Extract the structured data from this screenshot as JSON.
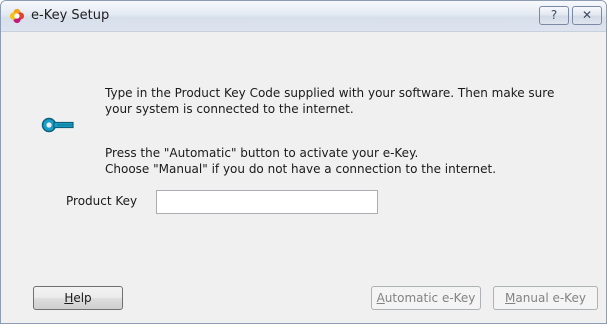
{
  "window": {
    "title": "e-Key Setup",
    "help_glyph": "?",
    "close_glyph": "✕",
    "app_icon": "setup-flower-icon"
  },
  "instructions": {
    "line1": "Type in the Product Key Code supplied with your software.  Then make sure",
    "line2": "your system is connected to the internet.",
    "line3": "Press the \"Automatic\" button to activate your e-Key.",
    "line4": "Choose \"Manual\" if you do not have a connection to the internet.",
    "icon": "key-icon"
  },
  "form": {
    "product_key_label": "Product Key",
    "product_key_value": ""
  },
  "buttons": {
    "help_prefix": "",
    "help_accel": "H",
    "help_rest": "elp",
    "auto_accel": "A",
    "auto_rest": "utomatic e-Key",
    "manual_accel": "M",
    "manual_rest": "anual e-Key",
    "auto_enabled": false,
    "manual_enabled": false
  },
  "colors": {
    "dialog_bg": "#f0f0f0",
    "disabled_text": "#838383",
    "key_icon": "#1aa0c8"
  }
}
